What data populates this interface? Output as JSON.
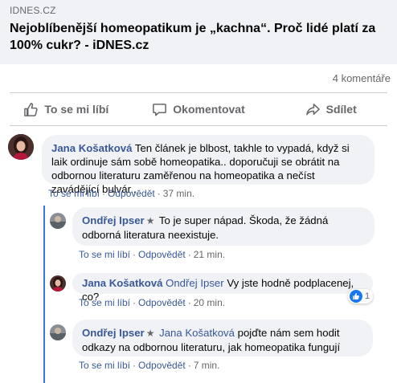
{
  "link_preview": {
    "domain": "IDNES.CZ",
    "title": "Nejoblíbenější homeopatikum je „kachna“. Proč lidé platí za 100% cukr? - iDNES.cz"
  },
  "counts": {
    "comments": "4 komentáře"
  },
  "actions": {
    "like": "To se mi líbí",
    "comment": "Okomentovat",
    "share": "Sdílet"
  },
  "comments": [
    {
      "author": "Jana Košatková",
      "text": "Ten článek je blbost, takhle to vypadá, když si laik ordinuje sám sobě homeopatika.. doporučuji se obrátit na odbornou literaturu zaměřenou na homeopatika a nečíst zavádějící bulvár..",
      "like": "To se mi líbí",
      "reply": "Odpovědět",
      "time": "37 min."
    }
  ],
  "replies": [
    {
      "author": "Ondřej Ipser",
      "mention": "",
      "text": "To je super nápad. Škoda, že žádná odborná literatura neexistuje.",
      "like": "To se mi líbí",
      "reply": "Odpovědět",
      "time": "21 min."
    },
    {
      "author": "Jana Košatková",
      "mention": "Ondřej Ipser",
      "text": "Vy jste hodně podplacenej, co?",
      "like": "To se mi líbí",
      "reply": "Odpovědět",
      "time": "20 min.",
      "reaction_count": "1"
    },
    {
      "author": "Ondřej Ipser",
      "mention": "Jana Košatková",
      "text": "pojďte nám sem hodit odkazy na odbornou literaturu, jak homeopatika fungují",
      "like": "To se mi líbí",
      "reply": "Odpovědět",
      "time": "7 min."
    }
  ],
  "colors": {
    "link_blue": "#385898",
    "bubble_bg": "#f0f2f5",
    "thread_line": "#3578e5",
    "muted": "#65676b"
  },
  "icons": [
    "thumbs-up-icon",
    "comment-icon",
    "share-icon",
    "star-icon"
  ]
}
